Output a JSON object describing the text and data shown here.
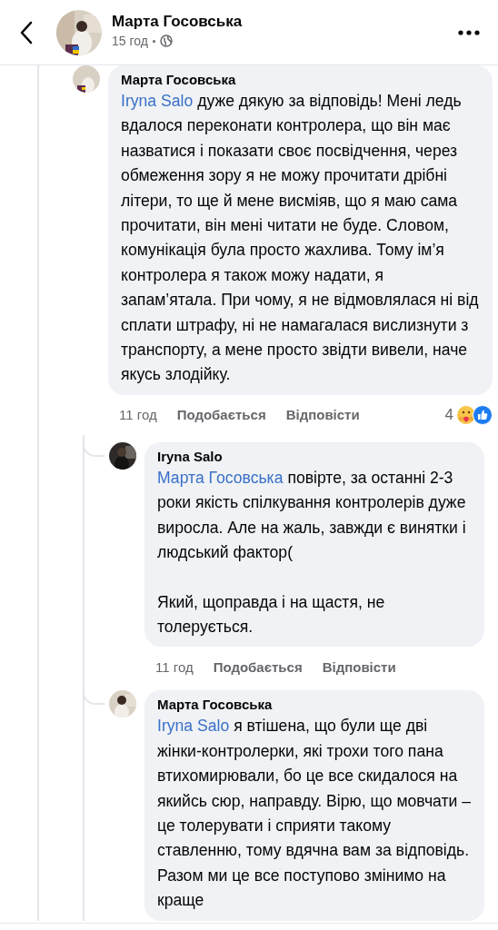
{
  "header": {
    "author": "Марта Госовська",
    "time": "15 год"
  },
  "comment": {
    "author": "Марта Госовська",
    "mention": "Iryna Salo",
    "paragraphs": [
      "дуже дякую за відповідь! Мені ледь вдалося переконати контролера, що він має назватися і показати своє посвідчення, через обмеження зору я не можу прочитати дрібні літери, то ще й мене висміяв, що я маю сама прочитати, він мені читати не буде. Словом, комунікація була просто жахлива. Тому ім’я контролера я також можу надати, я запам’ятала. При чому, я не відмовлялася ні від сплати штрафу, ні не намагалася вислизнути з транспорту, а мене просто звідти вивели, наче якусь злодійку."
    ],
    "time": "11 год",
    "like": "Подобається",
    "reply": "Відповісти",
    "reaction_count": "4"
  },
  "replies": [
    {
      "author": "Iryna Salo",
      "mention": "Марта Госовська",
      "paragraphs": [
        "повірте, за останні 2-3 роки якість спілкування контролерів дуже виросла. Але на жаль, завжди є винятки і людський фактор(",
        "Який, щоправда і на щастя, не толерується."
      ],
      "time": "11 год",
      "like": "Подобається",
      "reply": "Відповісти"
    },
    {
      "author": "Марта Госовська",
      "mention": "Iryna Salo",
      "paragraphs": [
        "я втішена, що були ще дві жінки-контролерки, які трохи того пана втихомирювали, бо це все скидалося на якийсь сюр, направду. Вірю, що мовчати – це толерувати і сприяти такому ставленню, тому вдячна вам за відповідь. Разом ми це все поступово змінимо на краще"
      ]
    }
  ]
}
